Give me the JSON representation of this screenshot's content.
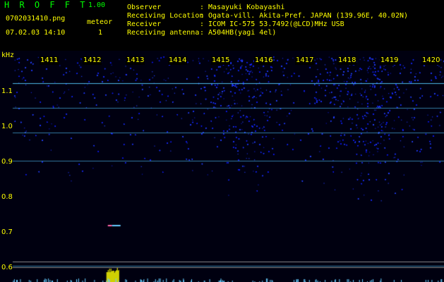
{
  "header": {
    "app_title": "H R O F F T",
    "app_version": "1.00",
    "file_name": "0702031410.png",
    "meteor_label": "meteor",
    "datetime": "07.02.03 14:10",
    "meteor_count": "1",
    "info_labels": "Observer\nReceiving Location\nReceiver\nReceiving antenna",
    "info_values": ": Masayuki Kobayashi\n: Ogata-vill. Akita-Pref. JAPAN (139.96E, 40.02N)\n: ICOM IC-575 53.7492(@LCD)MHz USB\n: A504HB(yagi 4el)",
    "label_color": "#ffff00",
    "title_color": "#00ff00"
  },
  "spectrogram": {
    "y_unit": "kHz",
    "y_ticks": [
      "1.1",
      "1.0",
      "0.9",
      "0.8",
      "0.7",
      "0.6"
    ],
    "y_tick_values": [
      1.1,
      1.0,
      0.9,
      0.8,
      0.7,
      0.6
    ],
    "x_ticks": [
      "1411",
      "1412",
      "1413",
      "1414",
      "1415",
      "1416",
      "1417",
      "1418",
      "1419",
      "1420"
    ],
    "x_tick_values": [
      1411,
      1412,
      1413,
      1414,
      1415,
      1416,
      1417,
      1418,
      1419,
      1420
    ],
    "background_color": "#000010",
    "noise_color": "#2a4aff",
    "tone_color": "#55ccff",
    "carrier_lines_khz": [
      1.123,
      1.052,
      0.983,
      0.903,
      0.605
    ],
    "meteor_echo_time": 1412.5
  }
}
